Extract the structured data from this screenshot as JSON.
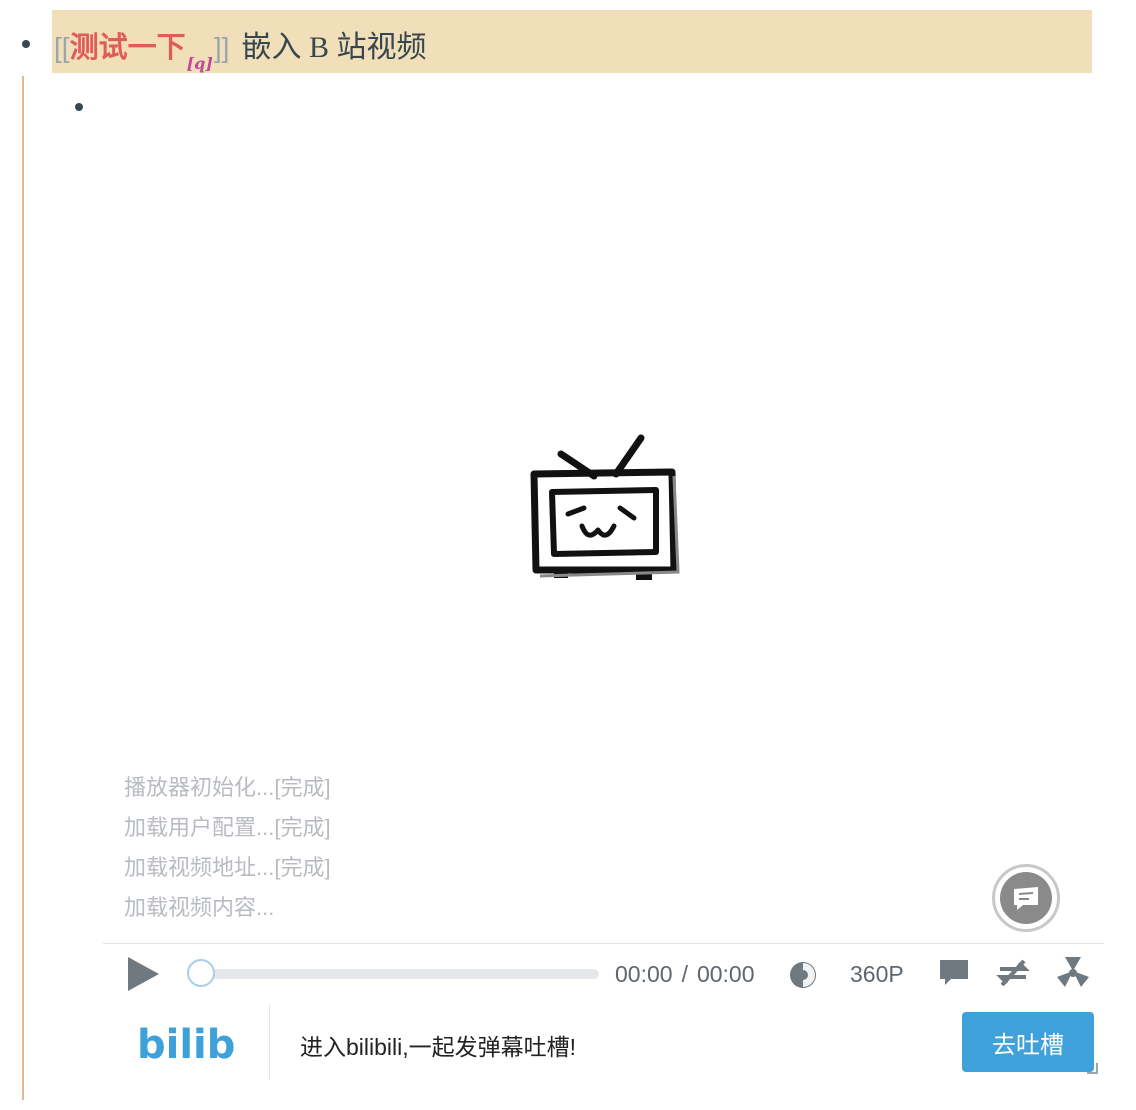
{
  "outline": {
    "page_ref_open": "[[",
    "page_ref": "测试一下",
    "page_ref_close": "]]",
    "page_ref_tag": "[q]",
    "title": "嵌入 B 站视频"
  },
  "player": {
    "loading_log": [
      "播放器初始化...[完成]",
      "加载用户配置...[完成]",
      "加载视频地址...[完成]",
      "加载视频内容..."
    ],
    "time_current": "00:00",
    "time_separator": "/",
    "time_total": "00:00",
    "quality": "360P",
    "progress": 0,
    "footer_text": "进入bilibili,一起发弹幕吐槽!",
    "footer_button": "去吐槽",
    "logo_text": "bilibili"
  },
  "colors": {
    "highlight": "#f1dfb9",
    "page_ref": "#e05c5c",
    "accent_button": "#3fa1d9",
    "thread_line": "#ebb48f"
  },
  "icons": [
    "play-icon",
    "volume-icon",
    "danmaku-toggle-icon",
    "loop-icon",
    "radiation-icon",
    "danmaku-badge-icon",
    "tv-logo-icon"
  ]
}
